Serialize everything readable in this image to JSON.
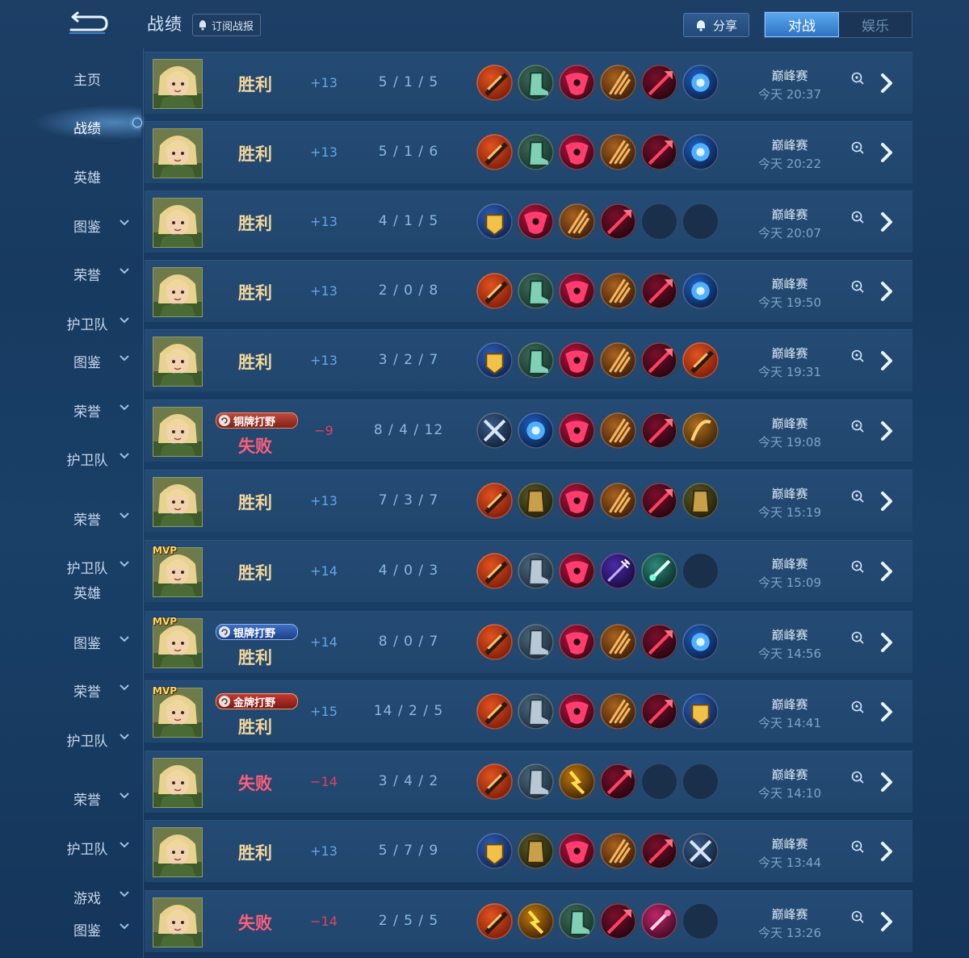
{
  "header": {
    "title": "战绩",
    "subscribe_label": "订阅战报",
    "share_label": "分享",
    "tabs": [
      {
        "label": "对战",
        "active": true
      },
      {
        "label": "娱乐",
        "active": false
      }
    ]
  },
  "sidebar": {
    "items": [
      {
        "label": "主页",
        "chevron": false,
        "active": false
      },
      {
        "label": "战绩",
        "chevron": false,
        "active": true
      },
      {
        "label": "英雄",
        "chevron": false,
        "active": false
      },
      {
        "label": "图鉴",
        "chevron": true,
        "active": false
      },
      {
        "label": "荣誉",
        "chevron": true,
        "active": false
      },
      {
        "label": "护卫队",
        "chevron": true,
        "active": false
      },
      {
        "label": "图鉴",
        "chevron": true,
        "active": false
      },
      {
        "label": "荣誉",
        "chevron": true,
        "active": false
      },
      {
        "label": "护卫队",
        "chevron": true,
        "active": false
      },
      {
        "label": "荣誉",
        "chevron": true,
        "active": false
      },
      {
        "label": "护卫队",
        "chevron": true,
        "active": false
      },
      {
        "label": "英雄",
        "chevron": false,
        "active": false
      },
      {
        "label": "图鉴",
        "chevron": true,
        "active": false
      },
      {
        "label": "荣誉",
        "chevron": true,
        "active": false
      },
      {
        "label": "护卫队",
        "chevron": true,
        "active": false
      },
      {
        "label": "荣誉",
        "chevron": true,
        "active": false
      },
      {
        "label": "护卫队",
        "chevron": true,
        "active": false
      },
      {
        "label": "游戏",
        "chevron": true,
        "active": false
      },
      {
        "label": "图鉴",
        "chevron": true,
        "active": false
      }
    ]
  },
  "colors": {
    "win": "#f3d69b",
    "loss": "#ff5d78",
    "score_positive": "#5ea6e6",
    "score_negative": "#e24258",
    "accent": "#3d8fe0"
  },
  "item_icons": {
    "A": "red-blade-item-icon",
    "B": "green-boots-item-icon",
    "C": "crimson-mask-item-icon",
    "D": "golden-claw-item-icon",
    "E": "dark-spear-item-icon",
    "F": "blue-orb-item-icon",
    "G": "golden-gauntlet-item-icon",
    "H": "steel-boots-item-icon",
    "I": "crossed-swords-item-icon",
    "J": "amber-bow-item-icon",
    "K": "bronze-armor-item-icon",
    "L": "violet-trident-item-icon",
    "M": "jade-sword-item-icon",
    "N": "lightning-claw-item-icon",
    "O": "pink-wand-item-icon",
    "X": "empty-slot-icon"
  },
  "matches": [
    {
      "mvp": false,
      "badge": null,
      "result": "胜利",
      "outcome": "win",
      "score": "+13",
      "kda": "5 / 1 / 5",
      "items": [
        "A",
        "B",
        "C",
        "D",
        "E",
        "F"
      ],
      "mode": "巅峰赛",
      "time": "今天 20:37"
    },
    {
      "mvp": false,
      "badge": null,
      "result": "胜利",
      "outcome": "win",
      "score": "+13",
      "kda": "5 / 1 / 6",
      "items": [
        "A",
        "B",
        "C",
        "D",
        "E",
        "F"
      ],
      "mode": "巅峰赛",
      "time": "今天 20:22"
    },
    {
      "mvp": false,
      "badge": null,
      "result": "胜利",
      "outcome": "win",
      "score": "+13",
      "kda": "4 / 1 / 5",
      "items": [
        "G",
        "C",
        "D",
        "E",
        "X",
        "X"
      ],
      "mode": "巅峰赛",
      "time": "今天 20:07"
    },
    {
      "mvp": false,
      "badge": null,
      "result": "胜利",
      "outcome": "win",
      "score": "+13",
      "kda": "2 / 0 / 8",
      "items": [
        "A",
        "B",
        "C",
        "D",
        "E",
        "F"
      ],
      "mode": "巅峰赛",
      "time": "今天 19:50"
    },
    {
      "mvp": false,
      "badge": null,
      "result": "胜利",
      "outcome": "win",
      "score": "+13",
      "kda": "3 / 2 / 7",
      "items": [
        "G",
        "B",
        "C",
        "D",
        "E",
        "A"
      ],
      "mode": "巅峰赛",
      "time": "今天 19:31"
    },
    {
      "mvp": false,
      "badge": {
        "label": "铜牌打野",
        "tier": "bronze"
      },
      "result": "失败",
      "outcome": "loss",
      "score": "−9",
      "kda": "8 / 4 / 12",
      "items": [
        "I",
        "F",
        "C",
        "D",
        "E",
        "J"
      ],
      "mode": "巅峰赛",
      "time": "今天 19:08"
    },
    {
      "mvp": false,
      "badge": null,
      "result": "胜利",
      "outcome": "win",
      "score": "+13",
      "kda": "7 / 3 / 7",
      "items": [
        "A",
        "K",
        "C",
        "D",
        "E",
        "K"
      ],
      "mode": "巅峰赛",
      "time": "今天 15:19"
    },
    {
      "mvp": true,
      "badge": null,
      "result": "胜利",
      "outcome": "win",
      "score": "+14",
      "kda": "4 / 0 / 3",
      "items": [
        "A",
        "H",
        "C",
        "L",
        "M",
        "X"
      ],
      "mode": "巅峰赛",
      "time": "今天 15:09"
    },
    {
      "mvp": true,
      "badge": {
        "label": "银牌打野",
        "tier": "silver"
      },
      "result": "胜利",
      "outcome": "win",
      "score": "+14",
      "kda": "8 / 0 / 7",
      "items": [
        "A",
        "H",
        "C",
        "D",
        "E",
        "F"
      ],
      "mode": "巅峰赛",
      "time": "今天 14:56"
    },
    {
      "mvp": true,
      "badge": {
        "label": "金牌打野",
        "tier": "gold"
      },
      "result": "胜利",
      "outcome": "win",
      "score": "+15",
      "kda": "14 / 2 / 5",
      "items": [
        "A",
        "H",
        "C",
        "D",
        "E",
        "G"
      ],
      "mode": "巅峰赛",
      "time": "今天 14:41"
    },
    {
      "mvp": false,
      "badge": null,
      "result": "失败",
      "outcome": "loss",
      "score": "−14",
      "kda": "3 / 4 / 2",
      "items": [
        "A",
        "H",
        "N",
        "E",
        "X",
        "X"
      ],
      "mode": "巅峰赛",
      "time": "今天 14:10"
    },
    {
      "mvp": false,
      "badge": null,
      "result": "胜利",
      "outcome": "win",
      "score": "+13",
      "kda": "5 / 7 / 9",
      "items": [
        "G",
        "K",
        "C",
        "D",
        "E",
        "I"
      ],
      "mode": "巅峰赛",
      "time": "今天 13:44"
    },
    {
      "mvp": false,
      "badge": null,
      "result": "失败",
      "outcome": "loss",
      "score": "−14",
      "kda": "2 / 5 / 5",
      "items": [
        "A",
        "N",
        "B",
        "E",
        "O",
        "X"
      ],
      "mode": "巅峰赛",
      "time": "今天 13:26"
    }
  ]
}
